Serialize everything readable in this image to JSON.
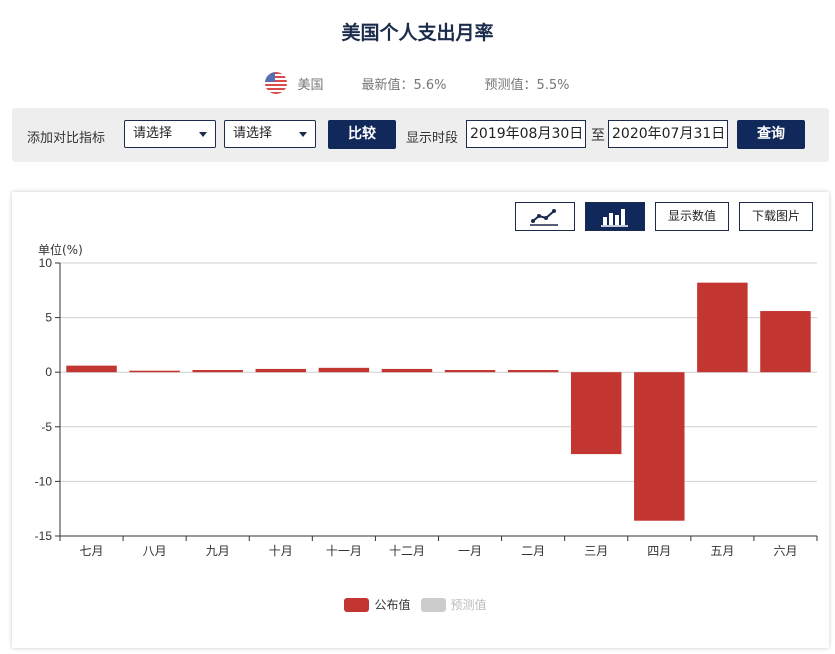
{
  "page": {
    "title": "美国个人支出月率"
  },
  "meta": {
    "country": "美国",
    "latest": "最新值：5.6%",
    "forecast": "预测值：5.5%"
  },
  "controls": {
    "compare_label": "添加对比指标",
    "select1": "请选择",
    "select2": "请选择",
    "compare_button": "比较",
    "period_label": "显示时段",
    "date_from": "2019年08月30日",
    "to_label": "至",
    "date_to": "2020年07月31日",
    "query_button": "查询"
  },
  "toolbar": {
    "show_values": "显示数值",
    "download": "下载图片"
  },
  "colors": {
    "published": "#c23531",
    "forecast": "#cccccc",
    "navy": "#10285a"
  },
  "chart_data": {
    "type": "bar",
    "unit_label": "单位(%)",
    "categories": [
      "七月",
      "八月",
      "九月",
      "十月",
      "十一月",
      "十二月",
      "一月",
      "二月",
      "三月",
      "四月",
      "五月",
      "六月"
    ],
    "series": [
      {
        "name": "公布值",
        "values": [
          0.6,
          0.1,
          0.2,
          0.3,
          0.4,
          0.3,
          0.2,
          0.2,
          -7.5,
          -13.6,
          8.2,
          5.6
        ]
      },
      {
        "name": "预测值",
        "values": []
      }
    ],
    "ylim": [
      -15,
      10
    ],
    "yticks": [
      10,
      5,
      0,
      -5,
      -10,
      -15
    ],
    "ytick_labels": [
      "10",
      "5",
      "0",
      "-5",
      "-10",
      "-15"
    ],
    "grid": true,
    "legend_position": "bottom-center"
  }
}
